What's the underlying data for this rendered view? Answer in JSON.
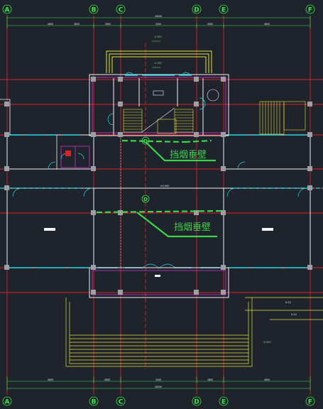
{
  "drawing": {
    "axes": {
      "top": [
        "A",
        "B",
        "C",
        "D",
        "E",
        "F"
      ],
      "bottom": [
        "A",
        "B",
        "C",
        "D",
        "E",
        "F"
      ],
      "middle_upper": "D",
      "middle_lower": "D"
    },
    "dimensions_top": {
      "total": "18200",
      "segments": [
        "4600",
        "2800",
        "3400",
        "2800",
        "4600"
      ]
    },
    "dimensions_bottom": {
      "total": "18200",
      "segments": [
        "4600",
        "2800",
        "3400",
        "2800",
        "4600"
      ]
    },
    "levels": {
      "entrance_top": "-0.300",
      "landing": "-0.150",
      "hall": "±0.000",
      "right_step_1": "0.12",
      "right_step_2": "0.12",
      "ramp_bottom": "-0.300"
    },
    "annotations": {
      "smoke_barrier_upper": "挡烟垂壁",
      "smoke_barrier_lower": "挡烟垂壁"
    },
    "colors": {
      "background": "#1e232c",
      "axis_red": "#d8202a",
      "wall_white": "#f2f2f2",
      "window_cyan": "#27d7e6",
      "stair_yellow": "#e6e23a",
      "partition_magenta": "#e23bd6",
      "annotation_green": "#39d64a",
      "column_gray": "#9aa0a6"
    }
  }
}
